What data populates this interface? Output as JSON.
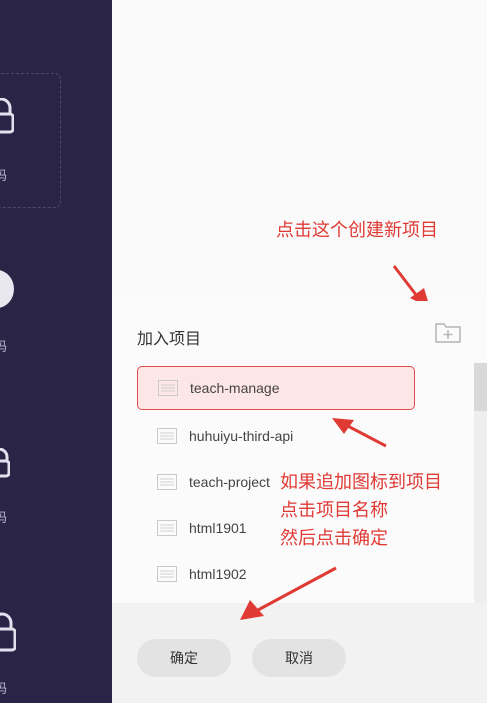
{
  "sidebar": {
    "labels": [
      "码",
      "码",
      "码",
      "码"
    ]
  },
  "dialog": {
    "title": "加入项目",
    "projects": [
      {
        "name": "teach-manage",
        "selected": true
      },
      {
        "name": "huhuiyu-third-api",
        "selected": false
      },
      {
        "name": "teach-project",
        "selected": false
      },
      {
        "name": "html1901",
        "selected": false
      },
      {
        "name": "html1902",
        "selected": false
      }
    ],
    "confirm_label": "确定",
    "cancel_label": "取消"
  },
  "annotations": {
    "top_note": "点击这个创建新项目",
    "middle_note_1": "如果追加图标到项目",
    "middle_note_2": "点击项目名称",
    "middle_note_3": "然后点击确定"
  },
  "colors": {
    "sidebar_bg": "#2a2546",
    "annotation_red": "#e03a35",
    "selected_bg": "#fde6e6",
    "selected_border": "#e04b4b"
  }
}
